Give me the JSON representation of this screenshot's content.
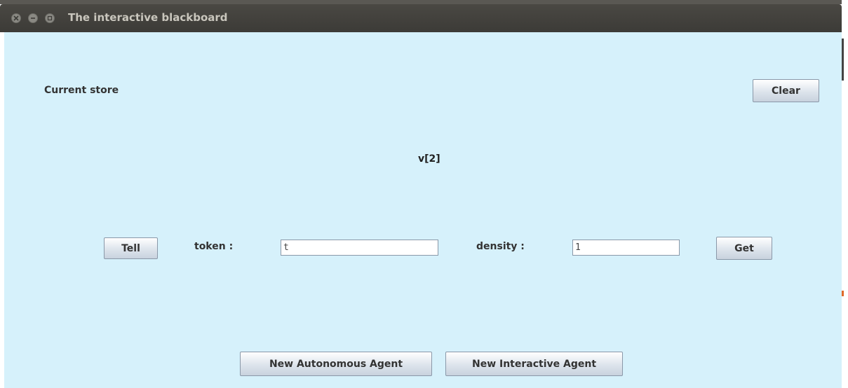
{
  "window": {
    "title": "The interactive blackboard"
  },
  "main": {
    "current_store_label": "Current store",
    "clear_button": "Clear",
    "store_value": "v[2]",
    "tell_button": "Tell",
    "token_label": "token :",
    "token_value": "t",
    "density_label": "density :",
    "density_value": "1",
    "get_button": "Get",
    "new_autonomous_agent_button": "New Autonomous Agent",
    "new_interactive_agent_button": "New Interactive Agent"
  },
  "colors": {
    "background": "#d6f1fb",
    "titlebar": "#3c3b37"
  }
}
